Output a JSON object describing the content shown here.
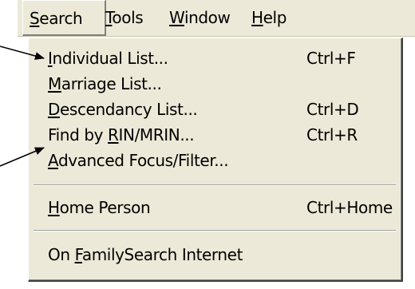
{
  "menubar": {
    "items": [
      {
        "pre": "",
        "mnemonic": "S",
        "post": "earch"
      },
      {
        "pre": "",
        "mnemonic": "T",
        "post": "ools"
      },
      {
        "pre": "",
        "mnemonic": "W",
        "post": "indow"
      },
      {
        "pre": "",
        "mnemonic": "H",
        "post": "elp"
      }
    ]
  },
  "search_menu": {
    "items": [
      {
        "pre": "",
        "mnemonic": "I",
        "post": "ndividual List...",
        "shortcut": "Ctrl+F"
      },
      {
        "pre": "",
        "mnemonic": "M",
        "post": "arriage List...",
        "shortcut": ""
      },
      {
        "pre": "",
        "mnemonic": "D",
        "post": "escendancy List...",
        "shortcut": "Ctrl+D"
      },
      {
        "pre": "Find by ",
        "mnemonic": "R",
        "post": "IN/MRIN...",
        "shortcut": "Ctrl+R"
      },
      {
        "pre": "",
        "mnemonic": "A",
        "post": "dvanced Focus/Filter...",
        "shortcut": ""
      },
      {
        "pre": "",
        "mnemonic": "H",
        "post": "ome Person",
        "shortcut": "Ctrl+Home"
      },
      {
        "pre": "On ",
        "mnemonic": "F",
        "post": "amilySearch Internet",
        "shortcut": ""
      }
    ]
  }
}
